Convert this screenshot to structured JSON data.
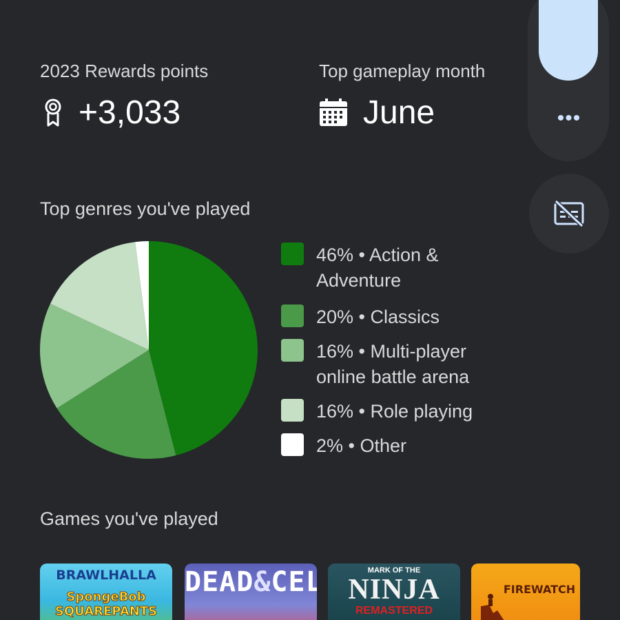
{
  "stats": {
    "rewards": {
      "label": "2023 Rewards points",
      "value": "+3,033",
      "icon": "award-ribbon-icon"
    },
    "month": {
      "label": "Top gameplay month",
      "value": "June",
      "icon": "calendar-icon"
    }
  },
  "rail": {
    "more_label": "•••",
    "more_icon": "more-dots-icon",
    "button_icon": "no-captions-icon"
  },
  "genres": {
    "title": "Top genres you've played",
    "legend": [
      {
        "label": "46% • Action & Adventure",
        "color": "#107c10"
      },
      {
        "label": "20% • Classics",
        "color": "#4a9a49"
      },
      {
        "label": "16% • Multi-player online battle arena",
        "color": "#8dc38c"
      },
      {
        "label": "16% • Role playing",
        "color": "#c5e0c4"
      },
      {
        "label": "2% • Other",
        "color": "#ffffff"
      }
    ]
  },
  "chart_data": {
    "type": "pie",
    "title": "Top genres you've played",
    "categories": [
      "Action & Adventure",
      "Classics",
      "Multi-player online battle arena",
      "Role playing",
      "Other"
    ],
    "values": [
      46,
      20,
      16,
      16,
      2
    ],
    "colors": [
      "#107c10",
      "#4a9a49",
      "#8dc38c",
      "#c5e0c4",
      "#ffffff"
    ],
    "legend": "right"
  },
  "games": {
    "title": "Games you've played",
    "tiles": [
      {
        "line1": "BRAWLHALLA",
        "line2": "SpongeBob SQUAREPANTS"
      },
      {
        "line1": "DEAD",
        "line2": "CELLS"
      },
      {
        "line1": "MARK OF THE",
        "line2": "NINJA",
        "line3": "REMASTERED"
      },
      {
        "line1": "FIREWATCH"
      }
    ]
  }
}
